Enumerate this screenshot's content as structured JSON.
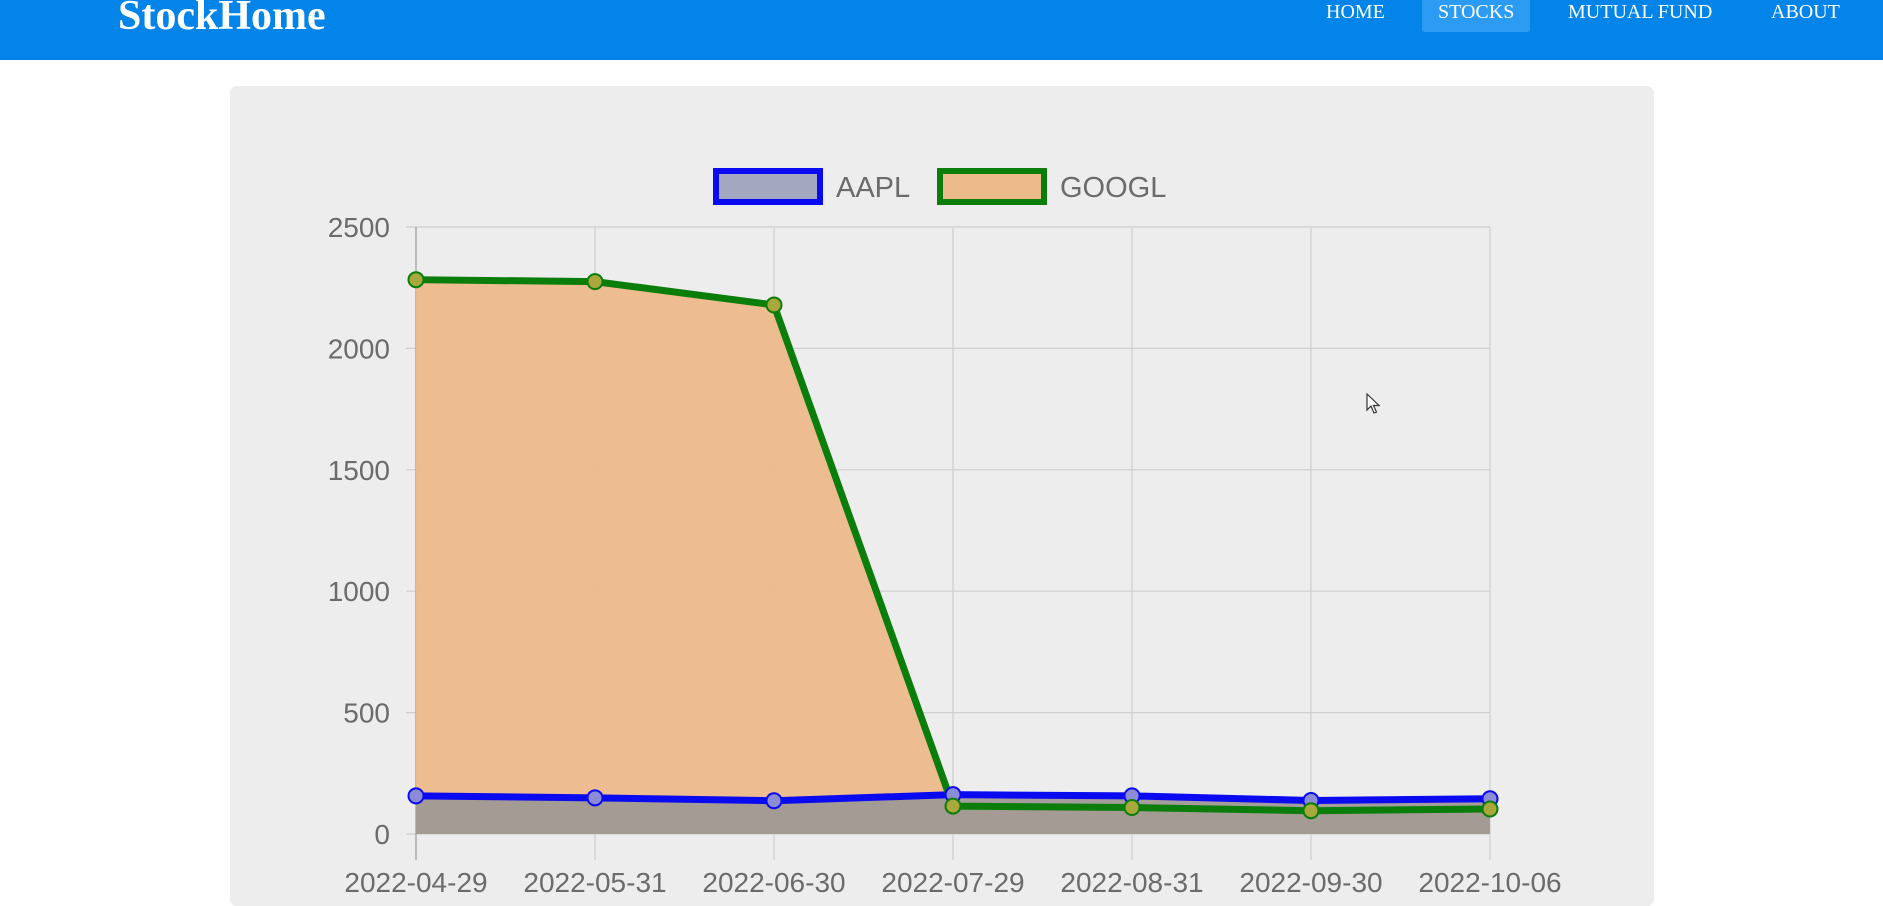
{
  "app": {
    "brand": "StockHome"
  },
  "nav": {
    "items": [
      {
        "label": "HOME",
        "active": false
      },
      {
        "label": "STOCKS",
        "active": true
      },
      {
        "label": "MUTUAL FUND",
        "active": false
      },
      {
        "label": "ABOUT",
        "active": false
      }
    ]
  },
  "colors": {
    "navbar": "#0284e8",
    "nav_active": "#2b9bf4",
    "card": "#ededee",
    "aapl_line": "#0a0af0",
    "aapl_fill": "#a3a7bf",
    "googl_line": "#0a7d0a",
    "googl_fill": "#edbb8b",
    "overlap_fill": "#a09996"
  },
  "chart_data": {
    "type": "line",
    "fill": true,
    "categories": [
      "2022-04-29",
      "2022-05-31",
      "2022-06-30",
      "2022-07-29",
      "2022-08-31",
      "2022-09-30",
      "2022-10-06"
    ],
    "series": [
      {
        "name": "AAPL",
        "values": [
          157,
          149,
          137,
          162,
          157,
          138,
          145
        ]
      },
      {
        "name": "GOOGL",
        "values": [
          2283,
          2275,
          2179,
          115,
          109,
          96,
          103
        ]
      }
    ],
    "yticks": [
      0,
      500,
      1000,
      1500,
      2000,
      2500
    ],
    "ylim": [
      0,
      2500
    ],
    "grid": true,
    "legend_position": "top"
  }
}
